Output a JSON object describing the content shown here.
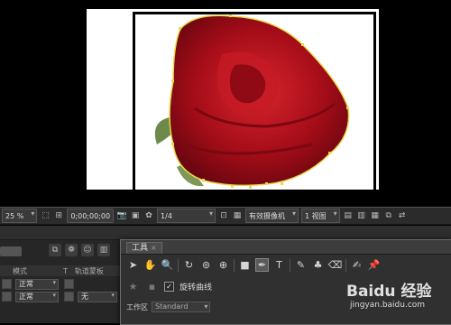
{
  "viewer_toolbar": {
    "zoom": "25 %",
    "timecode": "0;00;00;00",
    "resolution": "1/4",
    "camera": "有效摄像机",
    "views": "1 视图"
  },
  "timeline": {
    "header_col_mode": "模式",
    "header_col_t": "T",
    "header_col_trkmat": "轨道蒙板",
    "rows": [
      {
        "mode": "正常",
        "trkmat": ""
      },
      {
        "mode": "正常",
        "trkmat": "无"
      }
    ]
  },
  "tools_panel": {
    "tab_label": "工具",
    "tab_close": "×",
    "rotate_bezier_label": "旋转曲线",
    "rotate_bezier_checked": true,
    "workspace_label": "工作区",
    "workspace_value": "Standard"
  },
  "watermark": {
    "brand": "Baidu 经验",
    "url": "jingyan.baidu.com"
  },
  "colors": {
    "mask_path": "#e8d84a",
    "rose": "#b0101a",
    "panel_bg": "#303030"
  }
}
